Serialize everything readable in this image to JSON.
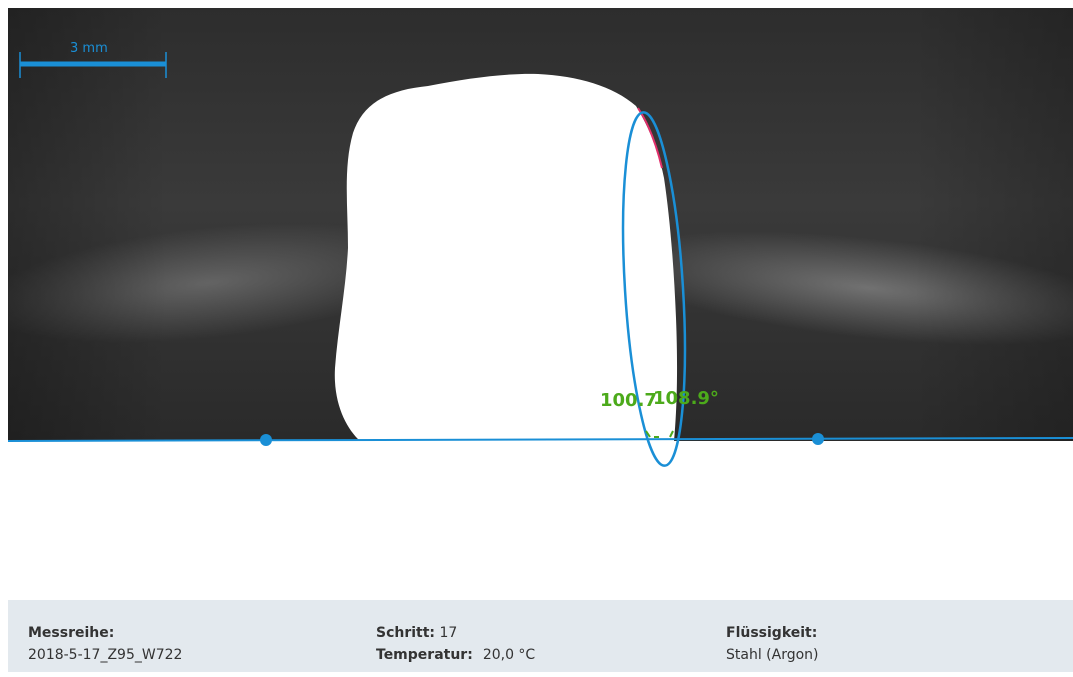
{
  "scale_bar": {
    "label": "3 mm"
  },
  "measurement": {
    "angle_left": "100.7",
    "angle_right": "108.9°"
  },
  "colors": {
    "accent": "#1a8fd6",
    "angle_text": "#4caa1b",
    "panel_background": "#e3e9ee"
  },
  "info": {
    "series_label": "Messreihe:",
    "series_value": "2018-5-17_Z95_W722",
    "step_label": "Schritt:",
    "step_value": "17",
    "temperature_label": "Temperatur:",
    "temperature_value": "20,0 °C",
    "liquid_label": "Flüssigkeit:",
    "liquid_value": "Stahl (Argon)"
  }
}
